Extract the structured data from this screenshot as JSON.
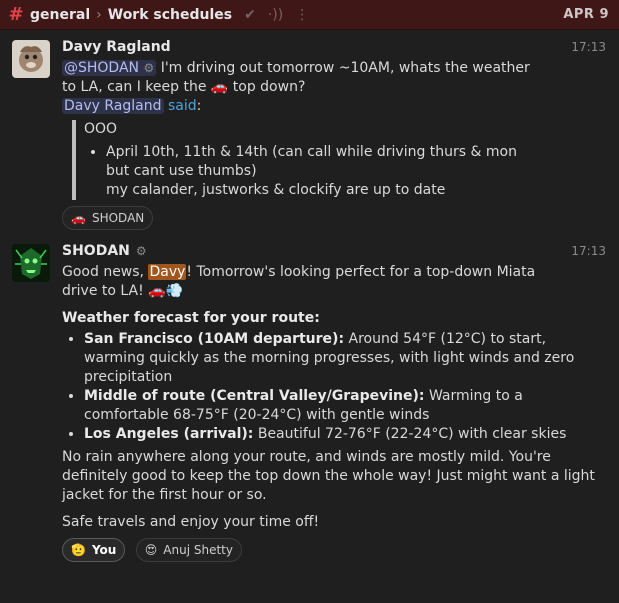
{
  "header": {
    "channel": "general",
    "thread": "Work schedules",
    "date": "APR 9",
    "icons": [
      "hash-icon",
      "chevron-right-icon",
      "check-icon",
      "radio-icon",
      "more-vertical-icon"
    ]
  },
  "message1": {
    "author": "Davy Ragland",
    "time": "17:13",
    "mention": "@SHODAN",
    "line1": " I'm driving out tomorrow ~10AM, whats the weather",
    "line2a": "to LA, can I keep the ",
    "car_emoji": "🚗",
    "line2b": " top down?",
    "quoted_user": "Davy Ragland",
    "said": "said",
    "quote_title": "OOO",
    "quote_item_line1": "April 10th, 11th & 14th (can call while driving thurs & mon",
    "quote_item_line2": "but cant use thumbs)",
    "quote_item_line3": "my calander, justworks & clockify are up to date",
    "reaction": {
      "emoji": "🚗",
      "label": "SHODAN"
    }
  },
  "message2": {
    "author": "SHODAN",
    "time": "17:13",
    "intro_a": "Good news, ",
    "intro_name": "Davy",
    "intro_b": "! Tomorrow's looking perfect for a top-down Miata",
    "intro_c": "drive to LA! ",
    "intro_emoji": "🚗💨",
    "forecast_title": "Weather forecast for your route:",
    "items": [
      {
        "label": "San Francisco (10AM departure):",
        "text": " Around 54°F (12°C) to start, warming quickly as the morning progresses, with light winds and zero precipitation"
      },
      {
        "label": "Middle of route (Central Valley/Grapevine):",
        "text": " Warming to a comfortable 68-75°F (20-24°C) with gentle winds"
      },
      {
        "label": "Los Angeles (arrival):",
        "text": " Beautiful 72-76°F (22-24°C) with clear skies"
      }
    ],
    "para1": "No rain anywhere along your route, and winds are mostly mild. You're definitely good to keep the top down the whole way! Just might want a light jacket for the first hour or so.",
    "para2": "Safe travels and enjoy your time off!",
    "reactions": [
      {
        "emoji": "🫡",
        "label": "You"
      },
      {
        "emoji": "😍",
        "label": "Anuj Shetty"
      }
    ]
  }
}
